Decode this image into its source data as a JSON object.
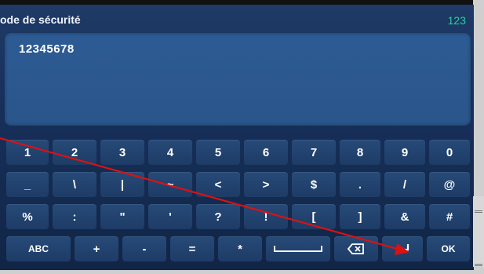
{
  "header": {
    "title": "ode de sécurité",
    "mode": "123"
  },
  "entry": {
    "value": "12345678"
  },
  "keyboard": {
    "row1": [
      "1",
      "2",
      "3",
      "4",
      "5",
      "6",
      "7",
      "8",
      "9",
      "0"
    ],
    "row2": [
      "_",
      "\\",
      "|",
      "~",
      "<",
      ">",
      "$",
      ".",
      "/",
      "@"
    ],
    "row3": [
      "%",
      ":",
      "\"",
      "'",
      "?",
      "!",
      "[",
      "]",
      "&",
      "#"
    ],
    "row4": {
      "abc": "ABC",
      "plus": "+",
      "minus": "-",
      "equals": "=",
      "star": "*",
      "ok": "OK"
    }
  },
  "icons": {
    "space": "space-icon",
    "backspace": "backspace-icon",
    "enter": "enter-icon"
  },
  "colors": {
    "arrow": "#dd1111",
    "mode": "#28d0a0"
  }
}
